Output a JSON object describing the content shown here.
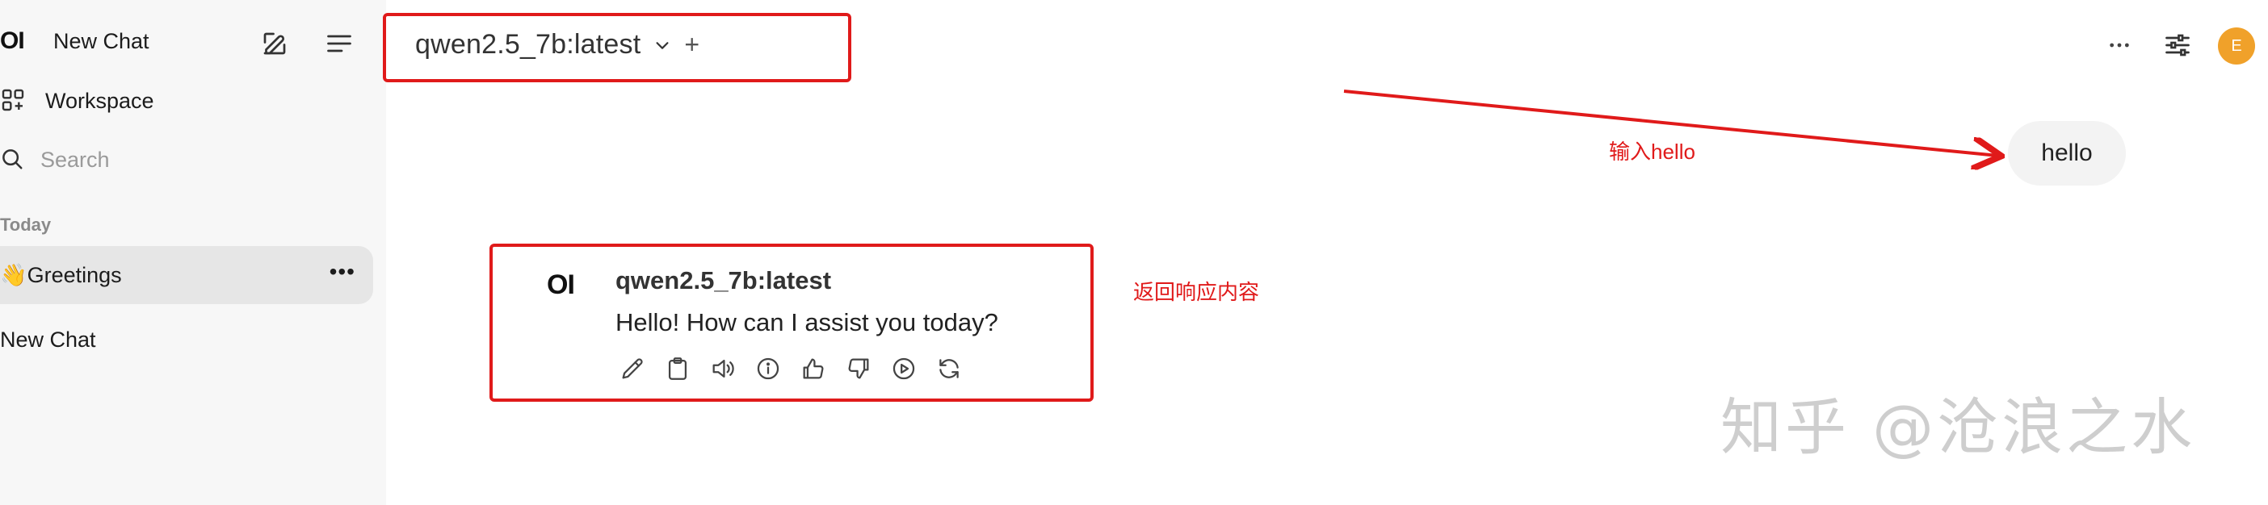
{
  "sidebar": {
    "logo": "OI",
    "new_chat_title": "New Chat",
    "workspace_label": "Workspace",
    "search_placeholder": "Search",
    "section_today": "Today",
    "chats": [
      {
        "label": "👋Greetings",
        "more": "•••"
      },
      {
        "label": "New Chat"
      }
    ]
  },
  "header": {
    "model": "qwen2.5_7b:latest",
    "add_model": "+",
    "more": "···",
    "avatar_initial": "E"
  },
  "conversation": {
    "user_message": "hello",
    "assistant": {
      "logo": "OI",
      "name": "qwen2.5_7b:latest",
      "text": "Hello! How can I assist you today?",
      "actions": [
        "edit-icon",
        "copy-icon",
        "speaker-icon",
        "info-icon",
        "thumbs-up-icon",
        "thumbs-down-icon",
        "play-icon",
        "regenerate-icon"
      ]
    }
  },
  "annotations": {
    "input_label": "输入hello",
    "response_label": "返回响应内容"
  },
  "watermark": "知乎 @沧浪之水",
  "colors": {
    "annotation_red": "#e01a1a",
    "avatar": "#f0a12a",
    "sidebar_bg": "#f7f7f7",
    "active_item_bg": "#e6e6e6"
  }
}
